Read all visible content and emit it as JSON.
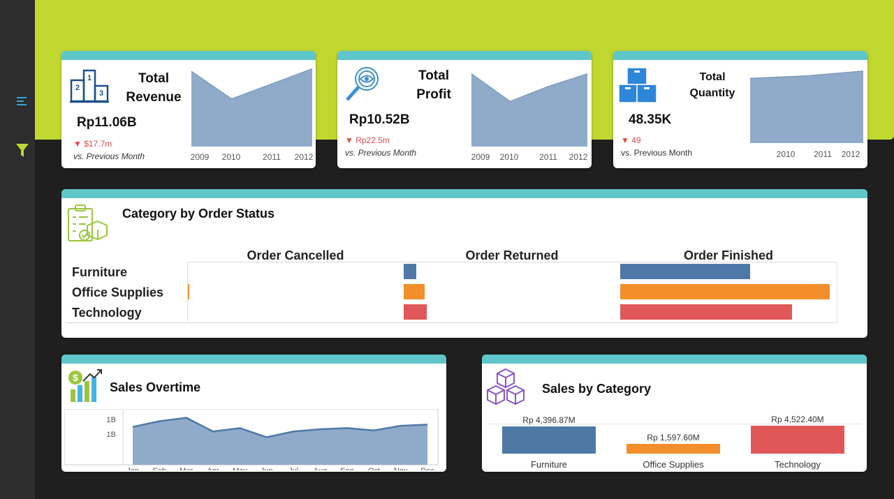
{
  "colors": {
    "lime": "#c0d730",
    "teal": "#5fc6c9",
    "area": "#8fabc9",
    "furniture": "#4e79a7",
    "office": "#f28e2b",
    "technology": "#e15759",
    "negative": "#e04a4a"
  },
  "sidebar": {
    "menu_icon": "list-menu-icon",
    "filter_icon": "filter-icon"
  },
  "kpis": [
    {
      "title_line1": "Total",
      "title_line2": "Revenue",
      "value": "Rp11.06B",
      "delta": "▼ $17.7m",
      "vs": "vs. Previous Month",
      "icon": "podium-icon",
      "chart_data": {
        "type": "area",
        "x": [
          "2009",
          "2010",
          "2011",
          "2012"
        ],
        "values": [
          3.0,
          1.9,
          2.5,
          3.1
        ]
      }
    },
    {
      "title_line1": "Total",
      "title_line2": "Profit",
      "value": "Rp10.52B",
      "delta": "▼ Rp22.5m",
      "vs": "vs. Previous Month",
      "icon": "magnifier-eye-icon",
      "chart_data": {
        "type": "area",
        "x": [
          "2009",
          "2010",
          "2011",
          "2012"
        ],
        "values": [
          2.9,
          1.8,
          2.4,
          2.9
        ]
      }
    },
    {
      "title_line1": "Total",
      "title_line2": "Quantity",
      "value": "48.35K",
      "delta": "▼ 49",
      "vs": "vs. Previous Month",
      "icon": "boxes-icon",
      "chart_data": {
        "type": "area",
        "x": [
          "2010",
          "2011",
          "2012"
        ],
        "values": [
          2.7,
          2.8,
          3.0
        ]
      }
    }
  ],
  "order_status": {
    "title": "Category by Order Status",
    "icon": "clipboard-package-icon",
    "columns": [
      "Order Cancelled",
      "Order Returned",
      "Order Finished"
    ],
    "chart_data": {
      "type": "bar",
      "categories": [
        "Furniture",
        "Office Supplies",
        "Technology"
      ],
      "series": [
        {
          "name": "Order Cancelled",
          "values": [
            0,
            0.5,
            0
          ]
        },
        {
          "name": "Order Returned",
          "values": [
            6,
            10,
            11
          ]
        },
        {
          "name": "Order Finished",
          "values": [
            62,
            100,
            82
          ]
        }
      ]
    }
  },
  "sales_overtime": {
    "title": "Sales Overtime",
    "icon": "money-chart-icon",
    "y_ticks": [
      "1B",
      "1B"
    ],
    "chart_data": {
      "type": "area",
      "x": [
        "Jan",
        "Feb",
        "Mar",
        "Apr",
        "May",
        "Jun",
        "Jul",
        "Aug",
        "Sep",
        "Oct",
        "Nov",
        "Dec"
      ],
      "values": [
        0.93,
        0.98,
        1.01,
        0.89,
        0.92,
        0.84,
        0.89,
        0.91,
        0.92,
        0.9,
        0.94,
        0.95
      ]
    }
  },
  "sales_by_category": {
    "title": "Sales by Category",
    "icon": "cubes-icon",
    "chart_data": {
      "type": "bar",
      "categories": [
        "Furniture",
        "Office Supplies",
        "Technology"
      ],
      "values": [
        4396.87,
        1597.6,
        4522.4
      ],
      "labels": [
        "Rp 4,396.87M",
        "Rp 1,597.60M",
        "Rp 4,522.40M"
      ]
    }
  }
}
